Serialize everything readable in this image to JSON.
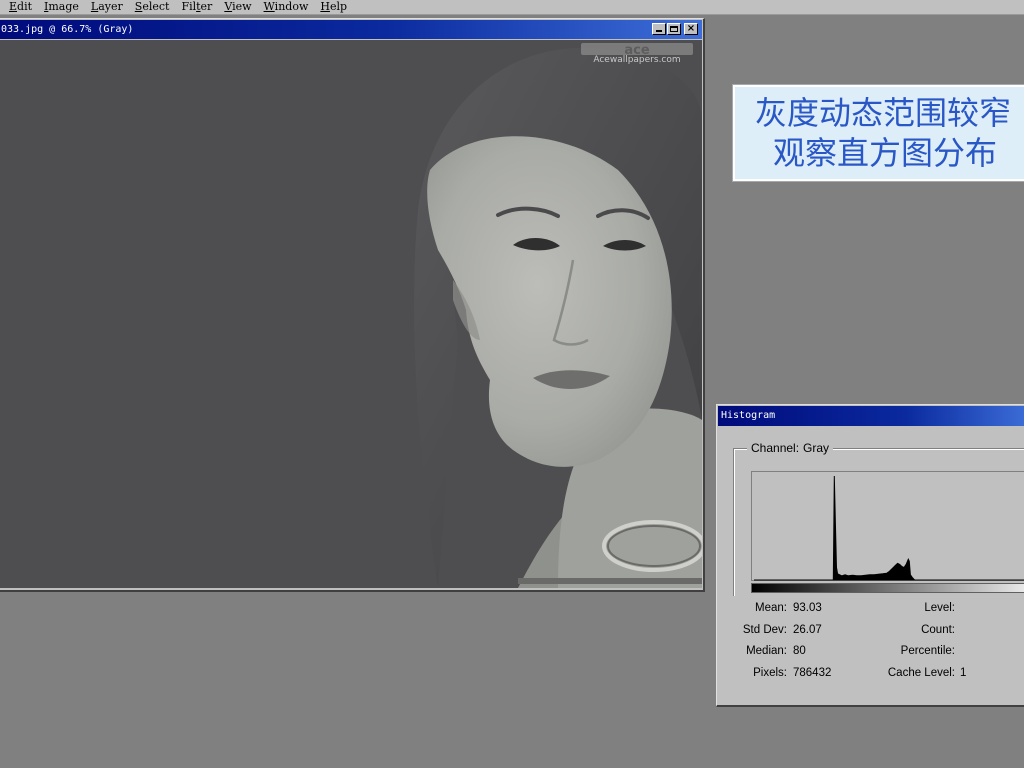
{
  "menubar": {
    "items": [
      {
        "label": "Edit",
        "key": "E",
        "rest": "dit"
      },
      {
        "label": "Image",
        "key": "I",
        "rest": "mage"
      },
      {
        "label": "Layer",
        "key": "L",
        "rest": "ayer"
      },
      {
        "label": "Select",
        "key": "S",
        "rest": "elect"
      },
      {
        "label": "Filter",
        "pre": "Fil",
        "key": "t",
        "rest": "er"
      },
      {
        "label": "View",
        "key": "V",
        "rest": "iew"
      },
      {
        "label": "Window",
        "key": "W",
        "rest": "indow"
      },
      {
        "label": "Help",
        "key": "H",
        "rest": "elp"
      }
    ]
  },
  "image_window": {
    "title": "033.jpg @ 66.7% (Gray)",
    "watermark_logo": "ace",
    "watermark_text": "Acewallpapers.com"
  },
  "annotation": {
    "line1": "灰度动态范围较窄",
    "line2": "观察直方图分布"
  },
  "histogram": {
    "title": "Histogram",
    "channel_label": "Channel:",
    "channel_value": "Gray",
    "stats": {
      "mean_label": "Mean:",
      "mean": "93.03",
      "stddev_label": "Std Dev:",
      "stddev": "26.07",
      "median_label": "Median:",
      "median": "80",
      "pixels_label": "Pixels:",
      "pixels": "786432",
      "level_label": "Level:",
      "count_label": "Count:",
      "percentile_label": "Percentile:",
      "cache_label": "Cache Level:",
      "cache": "1"
    }
  },
  "chart_data": {
    "type": "area",
    "title": "",
    "xlabel": "",
    "ylabel": "",
    "xlim": [
      0,
      255
    ],
    "ylim": [
      0,
      1
    ],
    "x": [
      0,
      70,
      74,
      75,
      76,
      77,
      78,
      80,
      82,
      85,
      88,
      92,
      96,
      100,
      104,
      108,
      112,
      116,
      120,
      124,
      126,
      128,
      130,
      132,
      134,
      136,
      138,
      140,
      142,
      144,
      145,
      146,
      148,
      150,
      255
    ],
    "values": [
      0,
      0,
      0,
      1.0,
      0.55,
      0.12,
      0.06,
      0.05,
      0.04,
      0.05,
      0.04,
      0.045,
      0.04,
      0.04,
      0.045,
      0.05,
      0.05,
      0.055,
      0.06,
      0.065,
      0.08,
      0.1,
      0.12,
      0.14,
      0.16,
      0.15,
      0.13,
      0.12,
      0.15,
      0.2,
      0.18,
      0.05,
      0.02,
      0,
      0
    ],
    "grid": false,
    "color": "#000000"
  }
}
